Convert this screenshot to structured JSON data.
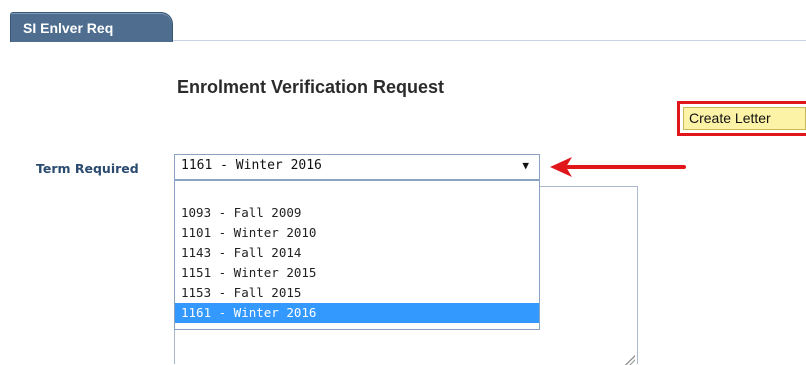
{
  "tab": {
    "label": "SI Enlver Req"
  },
  "page": {
    "title": "Enrolment Verification Request"
  },
  "toolbar": {
    "create_letter_label": "Create Letter"
  },
  "form": {
    "term_label": "Term Required",
    "term_selected": "1161 - Winter 2016",
    "term_options": [
      "1093 - Fall 2009",
      "1101 - Winter 2010",
      "1143 - Fall 2014",
      "1151 - Winter 2015",
      "1153 - Fall 2015",
      "1161 - Winter 2016"
    ]
  },
  "colors": {
    "tab_bg": "#4e6d8f",
    "highlight_box": "#e0161b",
    "button_bg": "#fdf3a6",
    "selected_option": "#3399ff",
    "label_text": "#2a4a6f"
  },
  "icons": {
    "caret": "caret-down-icon",
    "arrow": "red-arrow-left-icon"
  }
}
